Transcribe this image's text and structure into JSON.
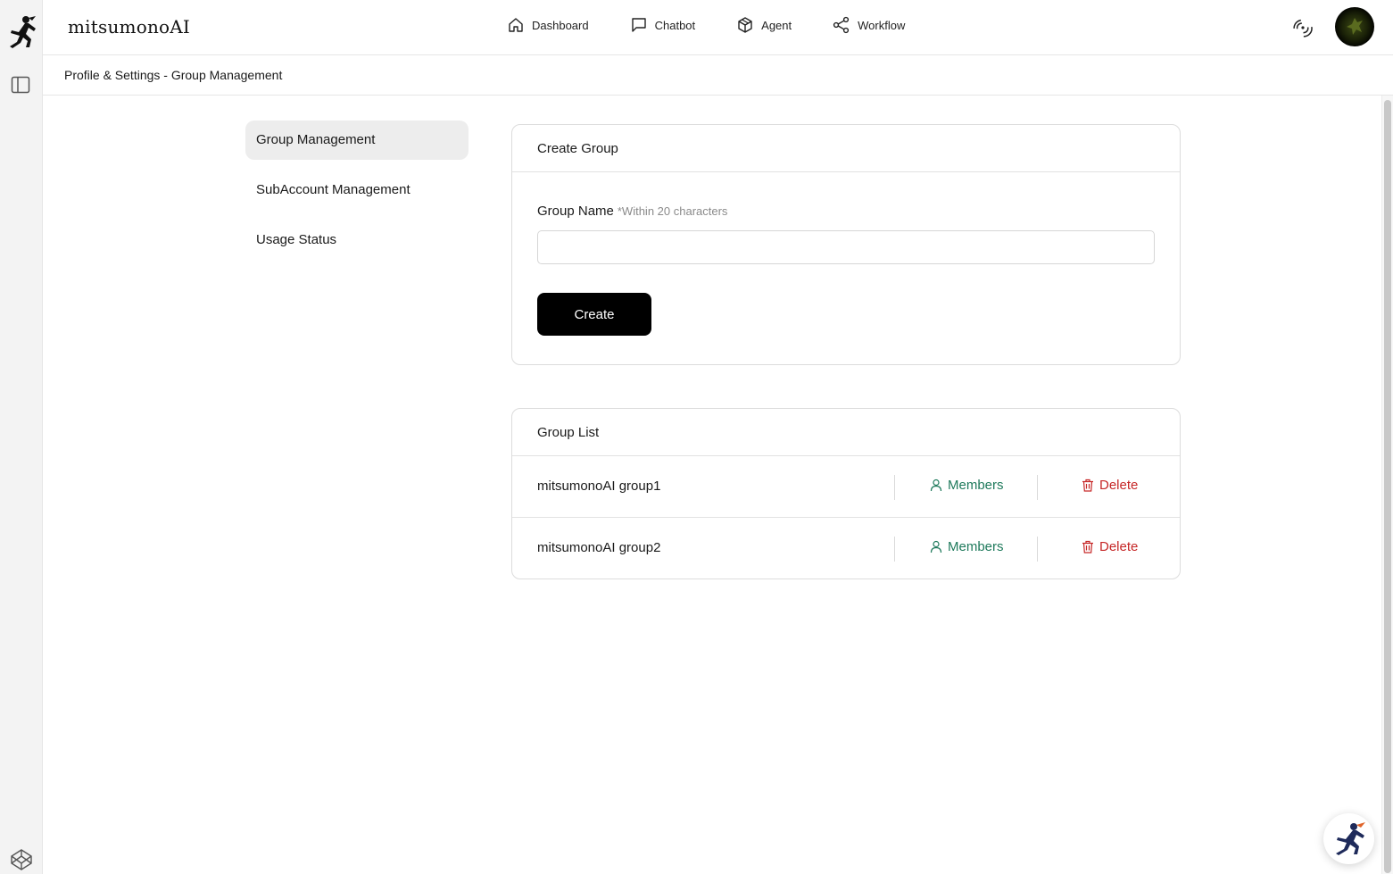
{
  "app": {
    "brand": "mitsumonoAI"
  },
  "header": {
    "nav": [
      {
        "label": "Dashboard",
        "icon": "home-icon"
      },
      {
        "label": "Chatbot",
        "icon": "chat-bubble-icon"
      },
      {
        "label": "Agent",
        "icon": "cube-icon"
      },
      {
        "label": "Workflow",
        "icon": "share-nodes-icon"
      }
    ]
  },
  "breadcrumb": "Profile & Settings - Group Management",
  "side_menu": [
    {
      "label": "Group Management",
      "active": true
    },
    {
      "label": "SubAccount Management",
      "active": false
    },
    {
      "label": "Usage Status",
      "active": false
    }
  ],
  "create_group": {
    "title": "Create Group",
    "field_label": "Group Name",
    "field_hint": "*Within 20 characters",
    "input_value": "",
    "button_label": "Create"
  },
  "group_list": {
    "title": "Group List",
    "rows": [
      {
        "name": "mitsumonoAI group1",
        "members_label": "Members",
        "delete_label": "Delete"
      },
      {
        "name": "mitsumonoAI group2",
        "members_label": "Members",
        "delete_label": "Delete"
      }
    ]
  },
  "colors": {
    "members": "#1f7a5c",
    "delete": "#c62828",
    "primary_button": "#000000"
  }
}
